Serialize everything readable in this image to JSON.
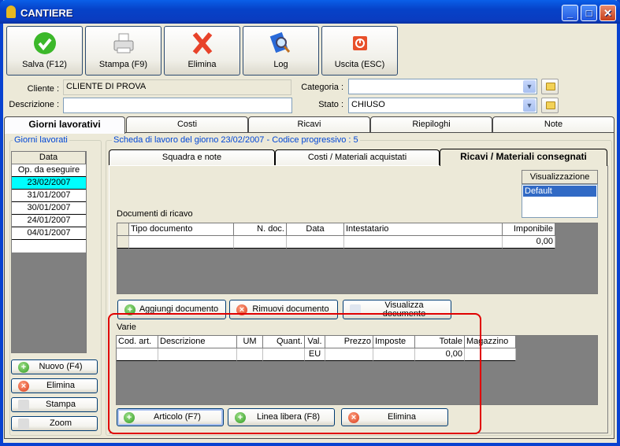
{
  "window": {
    "title": "CANTIERE"
  },
  "toolbar": [
    {
      "label": "Salva (F12)",
      "icon": "check-icon"
    },
    {
      "label": "Stampa (F9)",
      "icon": "printer-icon"
    },
    {
      "label": "Elimina",
      "icon": "delete-x-icon"
    },
    {
      "label": "Log",
      "icon": "log-magnifier-icon"
    },
    {
      "label": "Uscita (ESC)",
      "icon": "exit-icon"
    }
  ],
  "form": {
    "cliente_label": "Cliente :",
    "cliente_value": "CLIENTE DI PROVA",
    "descrizione_label": "Descrizione :",
    "descrizione_value": "",
    "categoria_label": "Categoria :",
    "categoria_value": "",
    "stato_label": "Stato :",
    "stato_value": "CHIUSO"
  },
  "tabs": [
    "Giorni lavorativi",
    "Costi",
    "Ricavi",
    "Riepiloghi",
    "Note"
  ],
  "active_tab": "Giorni lavorativi",
  "left": {
    "group_label": "Giorni lavorati",
    "column": "Data",
    "rows": [
      "Op. da eseguire",
      "23/02/2007",
      "31/01/2007",
      "30/01/2007",
      "24/01/2007",
      "04/01/2007"
    ],
    "selected": "23/02/2007",
    "buttons": [
      "Nuovo (F4)",
      "Elimina",
      "Stampa",
      "Zoom"
    ]
  },
  "right": {
    "group_label": "Scheda di lavoro del giorno 23/02/2007 - Codice progressivo : 5",
    "subtabs": [
      "Squadra e note",
      "Costi / Materiali acquistati",
      "Ricavi / Materiali consegnati"
    ],
    "active_subtab": "Ricavi / Materiali consegnati",
    "visualizzazione": {
      "header": "Visualizzazione",
      "items": [
        "Default"
      ],
      "selected": "Default"
    },
    "documenti": {
      "label": "Documenti di ricavo",
      "columns": [
        "Tipo documento",
        "N. doc.",
        "Data",
        "Intestatario",
        "Imponibile"
      ],
      "rows": [
        [
          "",
          "",
          "",
          "",
          "0,00"
        ]
      ],
      "buttons": [
        "Aggiungi documento",
        "Rimuovi documento",
        "Visualizza documento"
      ]
    },
    "varie": {
      "label": "Varie",
      "columns": [
        "Cod. art.",
        "Descrizione",
        "UM",
        "Quant.",
        "Val.",
        "Prezzo",
        "Imposte",
        "Totale",
        "Magazzino"
      ],
      "rows": [
        [
          "",
          "",
          "",
          "",
          "EU",
          "",
          "",
          "0,00",
          ""
        ]
      ],
      "buttons": [
        "Articolo (F7)",
        "Linea libera (F8)",
        "Elimina"
      ]
    }
  },
  "colors": {
    "highlight_annotation": "#e00000",
    "selected_row": "#00ffff",
    "list_selected": "#316ac5",
    "group_label": "#0046d5"
  }
}
